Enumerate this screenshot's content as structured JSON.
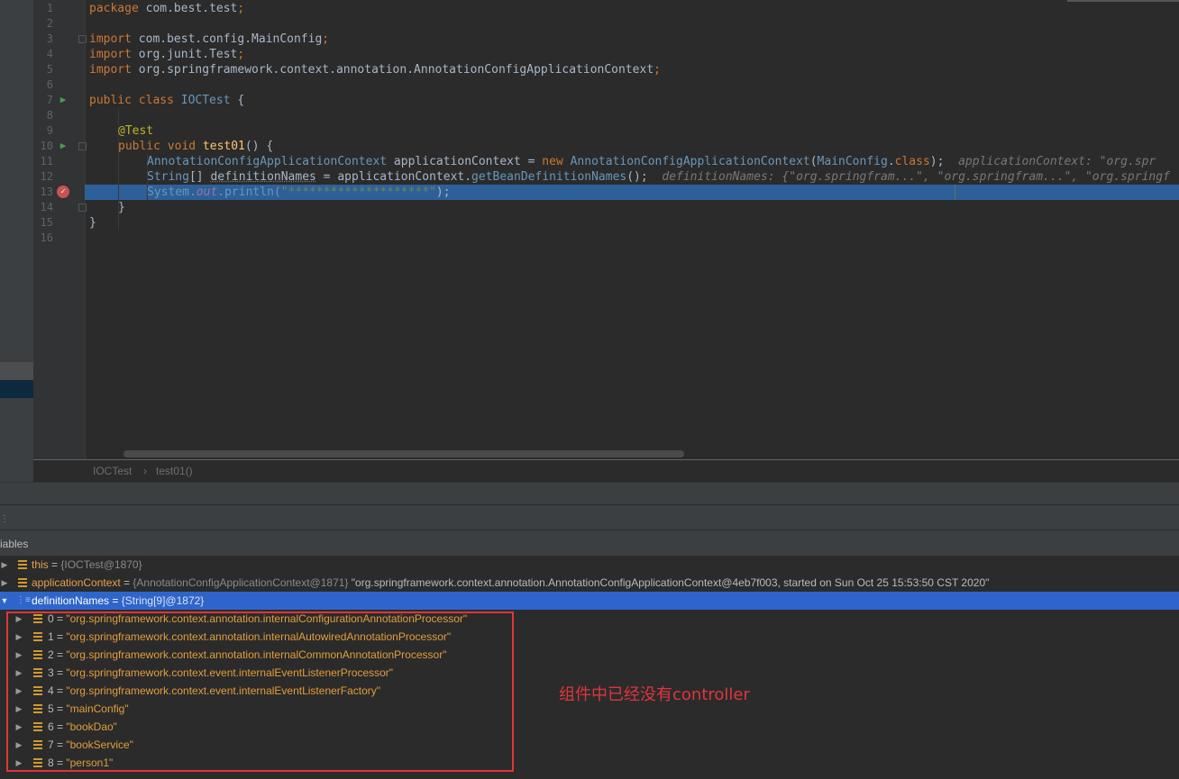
{
  "editor": {
    "line_numbers": [
      "1",
      "2",
      "3",
      "4",
      "5",
      "6",
      "7",
      "8",
      "9",
      "10",
      "11",
      "12",
      "13",
      "14",
      "15",
      "16"
    ],
    "lines": {
      "l1_kw": "package ",
      "l1_pkg": "com.best.test",
      "l1_end": ";",
      "l3_kw": "import ",
      "l3_pkg": "com.best.config.MainConfig",
      "l3_end": ";",
      "l4_kw": "import ",
      "l4_pkg": "org.junit.Test",
      "l4_end": ";",
      "l5_kw": "import ",
      "l5_pkg": "org.springframework.context.annotation.AnnotationConfigApplicationContext",
      "l5_end": ";",
      "l7_kw": "public class ",
      "l7_name": "IOCTest",
      "l7_end": " {",
      "l9_ann": "@Test",
      "l10_kw": "public void ",
      "l10_name": "test01",
      "l10_end": "() {",
      "l11_type": "AnnotationConfigApplicationContext",
      "l11_var": " applicationContext = ",
      "l11_new": "new ",
      "l11_ctor": "AnnotationConfigApplicationContext",
      "l11_p1": "(",
      "l11_arg": "MainConfig",
      "l11_dot": ".",
      "l11_kwclass": "class",
      "l11_end": ");",
      "l11_hint": "applicationContext: \"org.spr",
      "l12_type": "String",
      "l12_br": "[] ",
      "l12_var": "definitionNames",
      "l12_mid": " = applicationContext.",
      "l12_call": "getBeanDefinitionNames",
      "l12_end": "();",
      "l12_hint": "definitionNames: {\"org.springfram...\", \"org.springfram...\", \"org.springf",
      "l13_sys": "System.",
      "l13_out": "out",
      "l13_call": ".println(",
      "l13_str": "\"********************\"",
      "l13_end": ");",
      "l14": "}",
      "l15": "}"
    }
  },
  "breadcrumb": {
    "class_name": "IOCTest",
    "separator": "›",
    "method_name": "test01()"
  },
  "variables": {
    "title": "iables",
    "this_row": {
      "name": "this",
      "eq": " = ",
      "type": "{IOCTest@1870}"
    },
    "ctx_row": {
      "name": "applicationContext",
      "eq": " = ",
      "type": "{AnnotationConfigApplicationContext@1871} ",
      "value": "\"org.springframework.context.annotation.AnnotationConfigApplicationContext@4eb7f003, started on Sun Oct 25 15:53:50 CST 2020\""
    },
    "names_row": {
      "name": "definitionNames",
      "eq": " = ",
      "type": "{String[9]@1872}"
    },
    "items": [
      {
        "idx": "0",
        "eq": " = ",
        "value": "\"org.springframework.context.annotation.internalConfigurationAnnotationProcessor\""
      },
      {
        "idx": "1",
        "eq": " = ",
        "value": "\"org.springframework.context.annotation.internalAutowiredAnnotationProcessor\""
      },
      {
        "idx": "2",
        "eq": " = ",
        "value": "\"org.springframework.context.annotation.internalCommonAnnotationProcessor\""
      },
      {
        "idx": "3",
        "eq": " = ",
        "value": "\"org.springframework.context.event.internalEventListenerProcessor\""
      },
      {
        "idx": "4",
        "eq": " = ",
        "value": "\"org.springframework.context.event.internalEventListenerFactory\""
      },
      {
        "idx": "5",
        "eq": " = ",
        "value": "\"mainConfig\""
      },
      {
        "idx": "6",
        "eq": " = ",
        "value": "\"bookDao\""
      },
      {
        "idx": "7",
        "eq": " = ",
        "value": "\"bookService\""
      },
      {
        "idx": "8",
        "eq": " = ",
        "value": "\"person1\""
      }
    ]
  },
  "annotation_text": "组件中已经没有controller",
  "colors": {
    "accent_red": "#e0353b",
    "selection": "#2f65ca",
    "exec_line": "#2d6099"
  }
}
